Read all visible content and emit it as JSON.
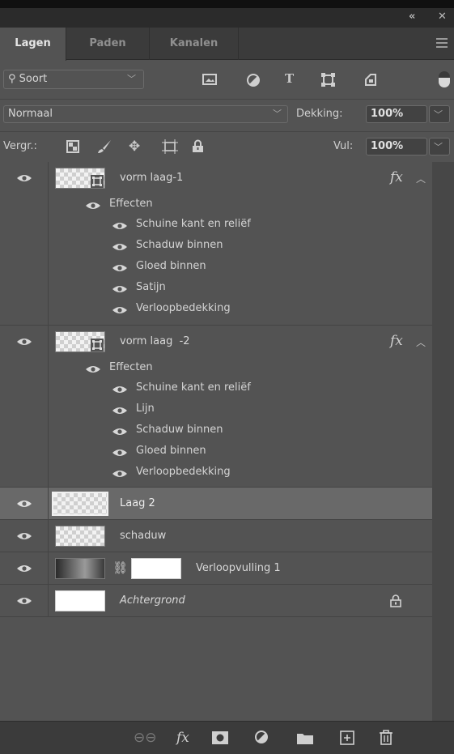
{
  "window": {
    "collapse_icon": "«",
    "close_icon": "✕"
  },
  "tabs": [
    {
      "label": "Lagen",
      "active": true
    },
    {
      "label": "Paden",
      "active": false
    },
    {
      "label": "Kanalen",
      "active": false
    }
  ],
  "filter": {
    "label": "Soort"
  },
  "blend": {
    "mode": "Normaal",
    "opacity_label": "Dekking:",
    "opacity_value": "100%"
  },
  "lock": {
    "label": "Vergr.:",
    "fill_label": "Vul:",
    "fill_value": "100%"
  },
  "layers": [
    {
      "name": "vorm laag-1",
      "effects_label": "Effecten",
      "effects": [
        "Schuine kant en reliëf",
        "Schaduw binnen",
        "Gloed binnen",
        "Satijn",
        "Verloopbedekking"
      ]
    },
    {
      "name": "vorm laag  -2",
      "effects_label": "Effecten",
      "effects": [
        "Schuine kant en reliëf",
        "Lijn",
        "Schaduw binnen",
        "Gloed binnen",
        "Verloopbedekking"
      ]
    },
    {
      "name": "Laag 2"
    },
    {
      "name": "schaduw"
    },
    {
      "name": "Verloopvulling 1"
    },
    {
      "name": "Achtergrond"
    }
  ],
  "colors": {
    "panel": "#535353",
    "selected": "#696969",
    "dark": "#3b3b3b"
  }
}
